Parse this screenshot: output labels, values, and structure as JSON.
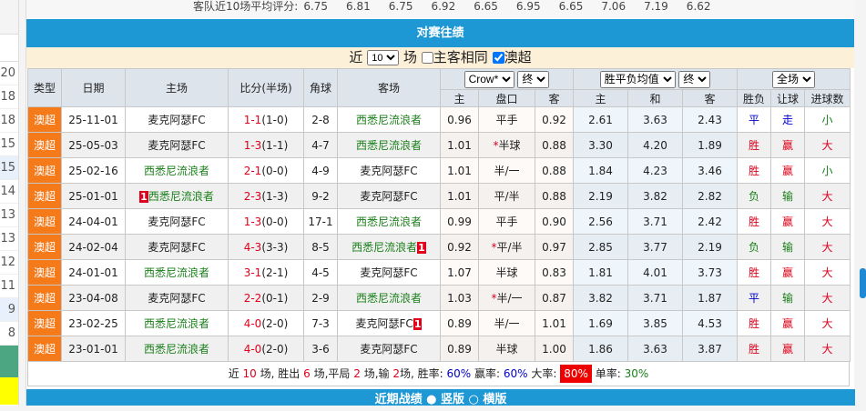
{
  "sidebar": {
    "values": [
      "20",
      "18",
      "18",
      "15",
      "15",
      "14",
      "13",
      "13",
      "12",
      "11",
      "9",
      "8"
    ]
  },
  "avg": {
    "label": "客队近10场平均评分:",
    "values": [
      "6.75",
      "6.81",
      "6.75",
      "6.92",
      "6.65",
      "6.95",
      "6.65",
      "7.06",
      "7.19",
      "6.62"
    ]
  },
  "title": "对赛往绩",
  "filter": {
    "prefix": "近",
    "count": "10",
    "suffix": "场",
    "same_label": "主客相同",
    "same_checked": false,
    "league_label": "澳超",
    "league_checked": true
  },
  "header": {
    "cols": [
      "类型",
      "日期",
      "主场",
      "比分(半场)",
      "角球",
      "客场"
    ],
    "company": "Crow*",
    "odds_stage": "终",
    "avg_select": "胜平负均值",
    "avg_stage": "终",
    "period": "全场",
    "sub": [
      "主",
      "盘口",
      "客",
      "主",
      "和",
      "客",
      "胜负",
      "让球",
      "进球数"
    ]
  },
  "rows": [
    {
      "type": "澳超",
      "date": "25-11-01",
      "home": "麦克阿瑟FC",
      "home_color": "black",
      "home_badge": "",
      "home_badge_pos": "",
      "score": "1-1",
      "half": "(1-0)",
      "corner": "2-8",
      "away": "西悉尼流浪者",
      "away_color": "green",
      "away_badge": "",
      "h": "0.96",
      "line": "平手",
      "star": false,
      "a": "0.92",
      "w": "2.61",
      "d": "3.63",
      "l": "2.43",
      "res": "平",
      "res_c": "blue",
      "hc": "走",
      "hc_c": "blue",
      "ou": "小",
      "ou_c": "green"
    },
    {
      "type": "澳超",
      "date": "25-05-03",
      "home": "麦克阿瑟FC",
      "home_color": "black",
      "home_badge": "",
      "score": "1-3",
      "half": "(1-1)",
      "corner": "4-7",
      "away": "西悉尼流浪者",
      "away_color": "green",
      "away_badge": "",
      "h": "1.01",
      "line": "半球",
      "star": true,
      "a": "0.88",
      "w": "3.30",
      "d": "4.20",
      "l": "1.89",
      "res": "胜",
      "res_c": "red",
      "hc": "赢",
      "hc_c": "red",
      "ou": "大",
      "ou_c": "red"
    },
    {
      "type": "澳超",
      "date": "25-02-16",
      "home": "西悉尼流浪者",
      "home_color": "green",
      "home_badge": "",
      "score": "2-1",
      "half": "(0-0)",
      "corner": "4-9",
      "away": "麦克阿瑟FC",
      "away_color": "black",
      "away_badge": "",
      "h": "1.01",
      "line": "半/一",
      "star": false,
      "a": "0.88",
      "w": "1.84",
      "d": "4.23",
      "l": "3.46",
      "res": "胜",
      "res_c": "red",
      "hc": "赢",
      "hc_c": "red",
      "ou": "小",
      "ou_c": "green"
    },
    {
      "type": "澳超",
      "date": "25-01-01",
      "home": "西悉尼流浪者",
      "home_color": "green",
      "home_badge": "1",
      "score": "2-3",
      "half": "(1-3)",
      "corner": "9-2",
      "away": "麦克阿瑟FC",
      "away_color": "black",
      "away_badge": "",
      "h": "1.01",
      "line": "平/半",
      "star": false,
      "a": "0.88",
      "w": "2.19",
      "d": "3.82",
      "l": "2.82",
      "res": "负",
      "res_c": "green",
      "hc": "输",
      "hc_c": "green",
      "ou": "大",
      "ou_c": "red"
    },
    {
      "type": "澳超",
      "date": "24-04-01",
      "home": "麦克阿瑟FC",
      "home_color": "black",
      "home_badge": "",
      "score": "1-3",
      "half": "(0-0)",
      "corner": "17-1",
      "away": "西悉尼流浪者",
      "away_color": "green",
      "away_badge": "",
      "h": "0.99",
      "line": "平手",
      "star": false,
      "a": "0.90",
      "w": "2.56",
      "d": "3.71",
      "l": "2.42",
      "res": "胜",
      "res_c": "red",
      "hc": "赢",
      "hc_c": "red",
      "ou": "大",
      "ou_c": "red"
    },
    {
      "type": "澳超",
      "date": "24-02-04",
      "home": "麦克阿瑟FC",
      "home_color": "black",
      "home_badge": "",
      "score": "4-3",
      "half": "(3-3)",
      "corner": "8-5",
      "away": "西悉尼流浪者",
      "away_color": "green",
      "away_badge": "1",
      "h": "0.92",
      "line": "平/半",
      "star": true,
      "a": "0.97",
      "w": "2.85",
      "d": "3.77",
      "l": "2.19",
      "res": "负",
      "res_c": "green",
      "hc": "输",
      "hc_c": "green",
      "ou": "大",
      "ou_c": "red"
    },
    {
      "type": "澳超",
      "date": "24-01-01",
      "home": "西悉尼流浪者",
      "home_color": "green",
      "home_badge": "",
      "score": "3-1",
      "half": "(2-1)",
      "corner": "4-5",
      "away": "麦克阿瑟FC",
      "away_color": "black",
      "away_badge": "",
      "h": "1.07",
      "line": "半球",
      "star": false,
      "a": "0.83",
      "w": "1.81",
      "d": "4.01",
      "l": "3.73",
      "res": "胜",
      "res_c": "red",
      "hc": "赢",
      "hc_c": "red",
      "ou": "大",
      "ou_c": "red"
    },
    {
      "type": "澳超",
      "date": "23-04-08",
      "home": "麦克阿瑟FC",
      "home_color": "black",
      "home_badge": "",
      "score": "2-2",
      "half": "(0-1)",
      "corner": "2-9",
      "away": "西悉尼流浪者",
      "away_color": "green",
      "away_badge": "",
      "h": "1.03",
      "line": "半/一",
      "star": true,
      "a": "0.87",
      "w": "3.82",
      "d": "3.71",
      "l": "1.87",
      "res": "平",
      "res_c": "blue",
      "hc": "输",
      "hc_c": "green",
      "ou": "大",
      "ou_c": "red"
    },
    {
      "type": "澳超",
      "date": "23-02-25",
      "home": "西悉尼流浪者",
      "home_color": "green",
      "home_badge": "",
      "score": "4-0",
      "half": "(2-0)",
      "corner": "7-3",
      "away": "麦克阿瑟FC",
      "away_color": "black",
      "away_badge": "1",
      "h": "0.89",
      "line": "半/一",
      "star": false,
      "a": "1.01",
      "w": "1.69",
      "d": "3.85",
      "l": "4.53",
      "res": "胜",
      "res_c": "red",
      "hc": "赢",
      "hc_c": "red",
      "ou": "大",
      "ou_c": "red"
    },
    {
      "type": "澳超",
      "date": "23-01-01",
      "home": "西悉尼流浪者",
      "home_color": "green",
      "home_badge": "",
      "score": "4-0",
      "half": "(2-0)",
      "corner": "3-6",
      "away": "麦克阿瑟FC",
      "away_color": "black",
      "away_badge": "",
      "h": "0.89",
      "line": "半球",
      "star": false,
      "a": "1.00",
      "w": "1.86",
      "d": "3.63",
      "l": "3.87",
      "res": "胜",
      "res_c": "red",
      "hc": "赢",
      "hc_c": "red",
      "ou": "大",
      "ou_c": "red"
    }
  ],
  "summary": {
    "t1": "近",
    "games": "10",
    "t2": "场, 胜出",
    "wins": "6",
    "t3": "场,平局",
    "draws": "2",
    "t4": "场,输",
    "losses": "2",
    "t5": "场, 胜率:",
    "win_rate": "60%",
    "t6": "赢率:",
    "hc_rate": "60%",
    "t7": "大率:",
    "over_rate": "80%",
    "t8": "单率:",
    "odd_rate": "30%"
  },
  "recent": {
    "title": "近期战绩",
    "opt1": "竖版",
    "opt2": "横版",
    "selected": "竖版"
  },
  "colors": {
    "blue_bar": "#1e98d4",
    "type_orange": "#f57a1a",
    "red": "#e0001b",
    "green": "#1a7f1a"
  }
}
